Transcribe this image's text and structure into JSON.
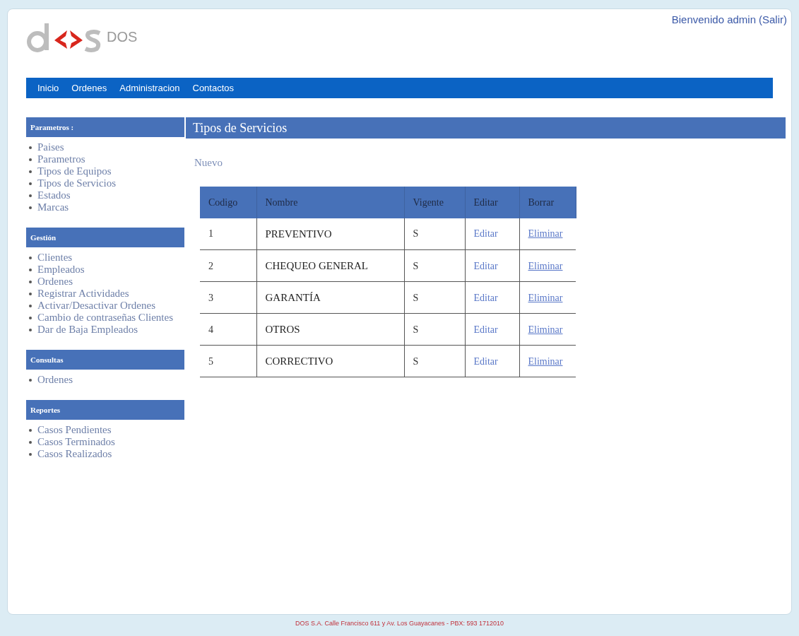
{
  "header": {
    "logo_text": "DOS",
    "user": {
      "greeting": "Bienvenido admin",
      "logout": "(Salir)"
    }
  },
  "nav": [
    {
      "label": "Inicio"
    },
    {
      "label": "Ordenes"
    },
    {
      "label": "Administracion"
    },
    {
      "label": "Contactos"
    }
  ],
  "sidebar": [
    {
      "title": "Parametros :",
      "items": [
        "Paises",
        "Parametros",
        "Tipos de Equipos",
        "Tipos de Servicios",
        "Estados",
        "Marcas"
      ]
    },
    {
      "title": "Gestión",
      "items": [
        "Clientes",
        "Empleados",
        "Ordenes",
        "Registrar Actividades",
        "Activar/Desactivar Ordenes",
        "Cambio de contraseñas Clientes",
        "Dar de Baja Empleados"
      ]
    },
    {
      "title": "Consultas",
      "items": [
        "Ordenes"
      ]
    },
    {
      "title": "Reportes",
      "items": [
        "Casos Pendientes",
        "Casos Terminados",
        "Casos Realizados"
      ]
    }
  ],
  "content": {
    "title": "Tipos de Servicios",
    "new_link": "Nuevo",
    "table": {
      "columns": [
        "Codigo",
        "Nombre",
        "Vigente",
        "Editar",
        "Borrar"
      ],
      "rows": [
        {
          "codigo": "1",
          "nombre": "PREVENTIVO",
          "vigente": "S",
          "edit": "Editar",
          "delete": "Eliminar"
        },
        {
          "codigo": "2",
          "nombre": "CHEQUEO GENERAL",
          "vigente": "S",
          "edit": "Editar",
          "delete": "Eliminar"
        },
        {
          "codigo": "3",
          "nombre": "GARANTÍA",
          "vigente": "S",
          "edit": "Editar",
          "delete": "Eliminar"
        },
        {
          "codigo": "4",
          "nombre": "OTROS",
          "vigente": "S",
          "edit": "Editar",
          "delete": "Eliminar"
        },
        {
          "codigo": "5",
          "nombre": "CORRECTIVO",
          "vigente": "S",
          "edit": "Editar",
          "delete": "Eliminar"
        }
      ]
    }
  },
  "footer": {
    "text": "DOS S.A. Calle Francisco 611 y Av. Los Guayacanes - PBX: 593 1712010"
  }
}
